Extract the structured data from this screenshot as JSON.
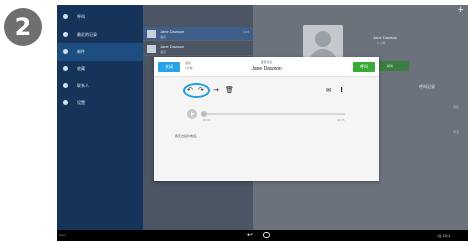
{
  "step_badge": "2",
  "sidebar": {
    "items": [
      {
        "label": "呼叫",
        "icon": "phone-icon"
      },
      {
        "label": "最近的记录",
        "icon": "clock-icon"
      },
      {
        "label": "邮件",
        "icon": "mail-icon"
      },
      {
        "label": "收藏",
        "icon": "star-icon"
      },
      {
        "label": "联系人",
        "icon": "person-icon"
      },
      {
        "label": "设置",
        "icon": "gear-icon"
      }
    ]
  },
  "background_list": {
    "rows": [
      {
        "name": "Jane Dawson",
        "sub": "语音",
        "time": "10:0"
      },
      {
        "name": "Jane Dawson",
        "sub": "语音",
        "time": ""
      }
    ]
  },
  "background_detail": {
    "contact_name": "Jane Dawson",
    "contact_sub": "2 小时",
    "call_label": "呼叫",
    "history_label": "呼叫记录",
    "row_time1": "周四",
    "row_time2": "周五"
  },
  "modal": {
    "close_label": "关闭",
    "meta_line1": "语音",
    "meta_line2": "1分钟",
    "sub_title": "语音消息",
    "title": "Jane Dawson",
    "call_label": "呼叫",
    "time_start": "00:00",
    "time_end": "00:15",
    "transcript": "我无法接听电话。"
  },
  "navbar": {
    "left_text": "cisco",
    "status_text": "◁) 10:1"
  }
}
